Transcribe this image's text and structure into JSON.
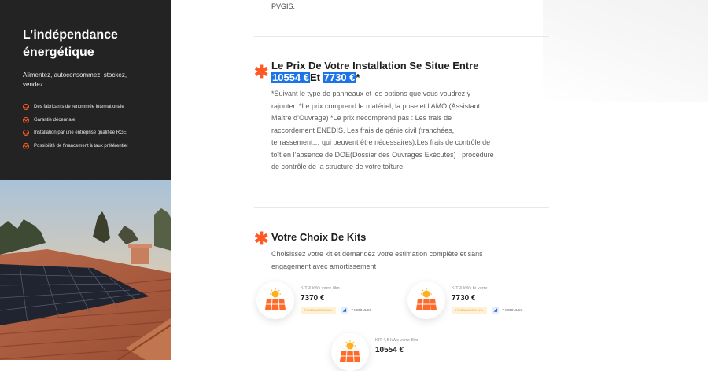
{
  "sidebar": {
    "title": "L’indépendance énergétique",
    "subtitle": "Alimentez, autoconsommez, stockez, vendez",
    "features": [
      "Des fabricants de renommée internationale",
      "Garantie décennale",
      "Installation par une entreprise qualifiée RGE",
      "Possibilité de financement à taux préférentiel"
    ]
  },
  "main": {
    "pvgis_text": "PVGIS.",
    "price_section": {
      "heading": "Le Prix De Votre Installation Se Situe Entre",
      "price_low": "10554 €",
      "connector": "Et",
      "price_high": "7730 €",
      "asterisk": "*",
      "body": "*Suivant le type de panneaux et les options que vous voudrez y rajouter. *Le prix comprend le matériel, la pose et l’AMO (Assistant Maître d’Ouvrage) *Le prix necomprend pas : Les frais de raccordement ENEDIS. Les frais de génie civil (tranchées, terrassement… qui peuvent être nécessaires).Les frais de contrôle de toît en l’absence de DOE(Dossier des Ouvrages Exécutés) : procédure de contrôle de la structure de votre toîture."
    },
    "kits_section": {
      "heading": "Votre Choix De Kits",
      "intro": "Choisissez votre kit et demandez votre estimation complète et sans engagement avec amortissement"
    },
    "kits": [
      {
        "name": "KIT 3 kWc verre-film",
        "price": "7370 €",
        "power_tag": "PUISSANCE 3 kWc",
        "modules": "7 MODULES"
      },
      {
        "name": "KIT 3 kWc bi-verre",
        "price": "7730 €",
        "power_tag": "PUISSANCE 3 kWc",
        "modules": "7 MODULES"
      },
      {
        "name": "KIT 4,5 kWc verre-film",
        "price": "10554 €"
      }
    ]
  },
  "colors": {
    "accent": "#ff5a24",
    "highlight": "#1d74e6",
    "dark_panel": "#232323"
  }
}
